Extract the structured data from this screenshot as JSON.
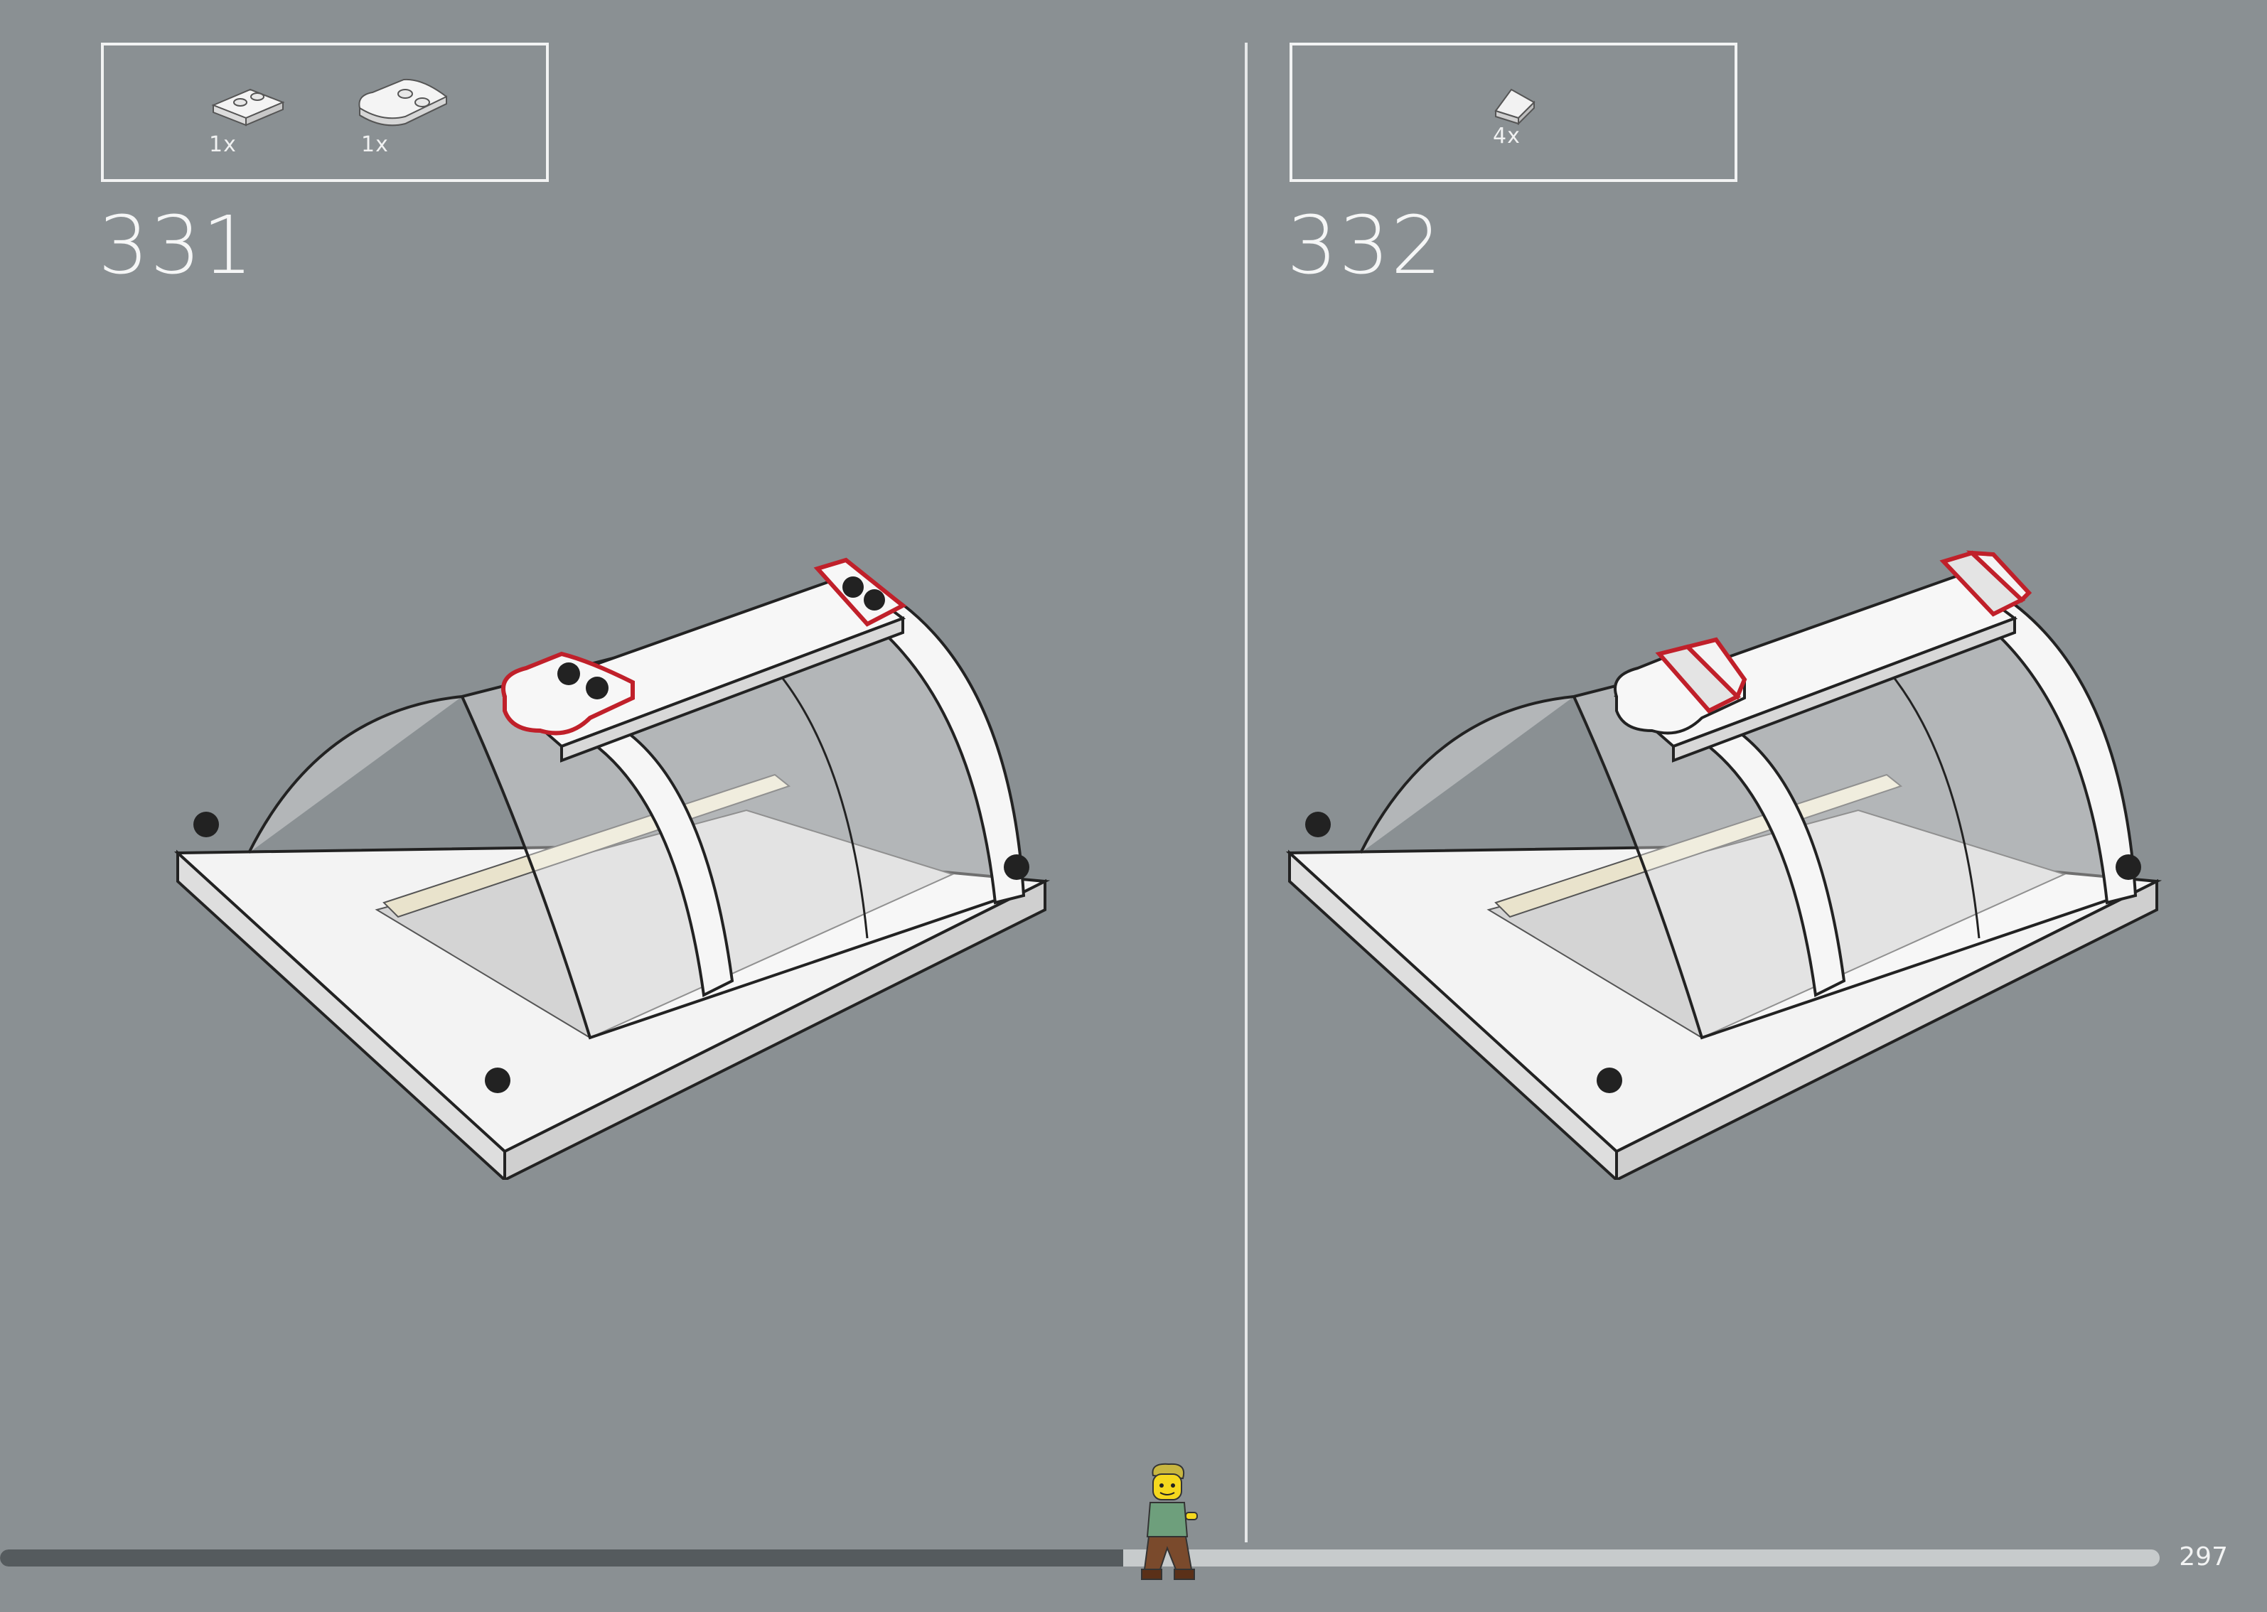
{
  "steps": [
    {
      "number": "331",
      "parts": [
        {
          "qty": "1x",
          "icon": "plate-1x2-icon"
        },
        {
          "qty": "1x",
          "icon": "wedge-plate-icon"
        }
      ]
    },
    {
      "number": "332",
      "parts": [
        {
          "qty": "4x",
          "icon": "slope-1x1-icon"
        }
      ]
    }
  ],
  "footer": {
    "page_number": "297",
    "progress": 0.52
  },
  "colors": {
    "background": "#8a9093",
    "highlight": "#c0202a",
    "track": "#c7cbcc",
    "fill": "#555b5e"
  }
}
